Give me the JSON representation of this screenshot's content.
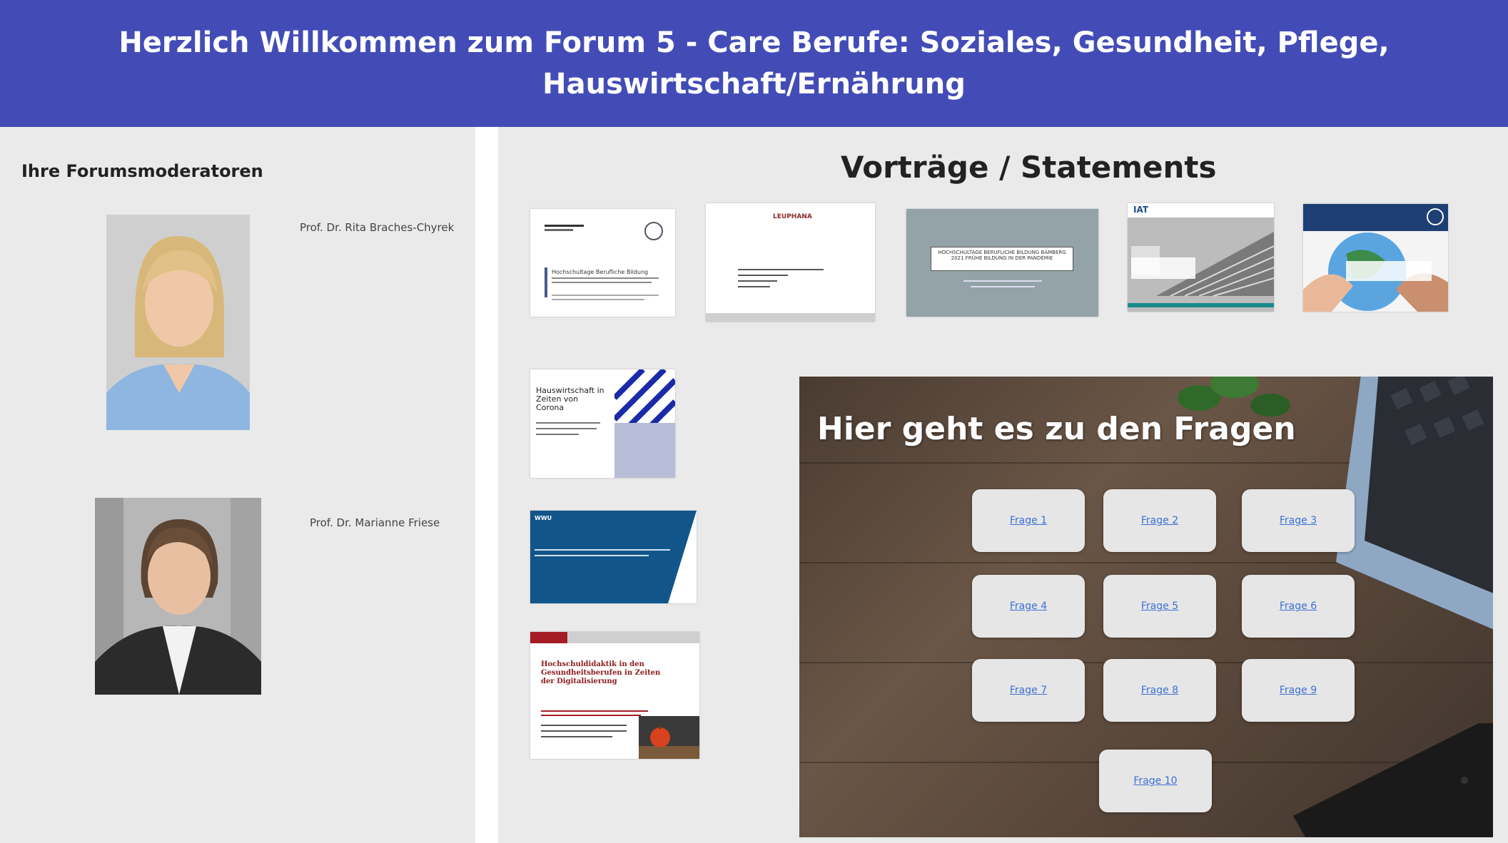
{
  "header": {
    "title_line1": "Herzlich Willkommen zum Forum 5 - Care Berufe: Soziales, Gesundheit, Pflege,",
    "title_line2": "Hauswirtschaft/Ernährung"
  },
  "moderators": {
    "title": "Ihre Forumsmoderatoren",
    "people": [
      {
        "name": "Prof. Dr. Rita Braches-Chyrek"
      },
      {
        "name": "Prof. Dr. Marianne Friese"
      }
    ]
  },
  "talks": {
    "title": "Vorträge / Statements",
    "thumbnails": [
      {
        "id": "talk-1",
        "text": "Hochschultage Berufliche Bildung"
      },
      {
        "id": "talk-2",
        "text": "LEUPHANA"
      },
      {
        "id": "talk-3",
        "text": "HOCHSCHULTAGE BERUFLICHE BILDUNG BAMBERG 2021 FRÜHE BILDUNG IN DER PANDEMIE"
      },
      {
        "id": "talk-4",
        "text": "IAT"
      },
      {
        "id": "talk-5",
        "text": ""
      },
      {
        "id": "talk-6",
        "text": "Hauswirtschaft in Zeiten von Corona"
      },
      {
        "id": "talk-7",
        "text": "WWU"
      },
      {
        "id": "talk-8",
        "text": "Hochschuldidaktik in den Gesundheitsberufen in Zeiten der Digitalisierung"
      }
    ]
  },
  "questions": {
    "title": "Hier geht es zu den Fragen",
    "buttons": [
      "Frage 1",
      "Frage 2",
      "Frage 3",
      "Frage 4",
      "Frage 5",
      "Frage 6",
      "Frage 7",
      "Frage 8",
      "Frage 9",
      "Frage 10"
    ]
  },
  "colors": {
    "header_bg": "#434cb6",
    "panel_bg": "#eaeaea",
    "link": "#3b6fd6"
  }
}
